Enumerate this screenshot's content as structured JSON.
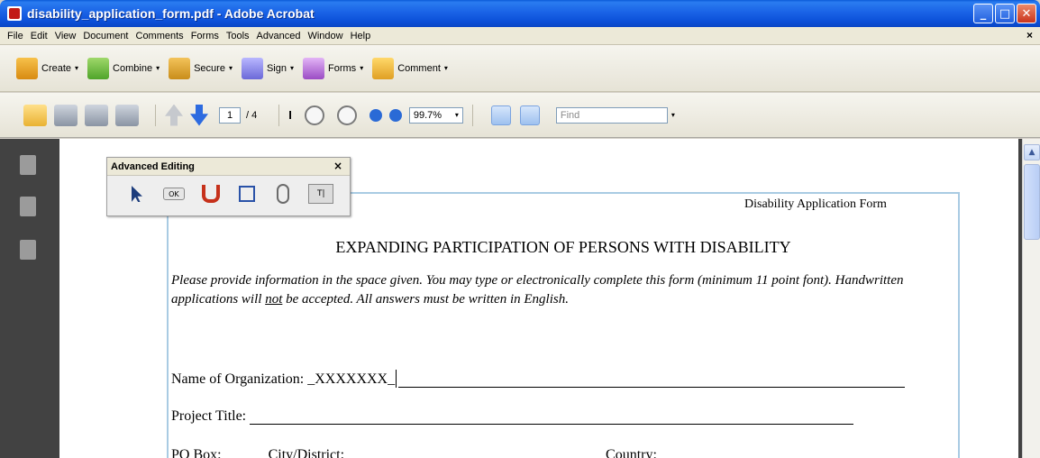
{
  "window": {
    "title": "disability_application_form.pdf - Adobe Acrobat",
    "minimize": "_",
    "maximize": "□",
    "close": "✕"
  },
  "menu": {
    "items": [
      "File",
      "Edit",
      "View",
      "Document",
      "Comments",
      "Forms",
      "Tools",
      "Advanced",
      "Window",
      "Help"
    ],
    "close": "×"
  },
  "toolbar1": {
    "create": "Create",
    "combine": "Combine",
    "secure": "Secure",
    "sign": "Sign",
    "forms": "Forms",
    "comment": "Comment",
    "dropdown_glyph": "▾"
  },
  "toolbar2": {
    "current_page": "1",
    "page_total": "/ 4",
    "select_tool": "I",
    "zoom": "99.7%",
    "dropdown_glyph": "▾",
    "find_placeholder": "Find"
  },
  "palette": {
    "title": "Advanced Editing",
    "close": "×",
    "ok_label": "OK",
    "textfield_label": "T|"
  },
  "document": {
    "header": "Disability Application Form",
    "title": "EXPANDING PARTICIPATION OF PERSONS WITH DISABILITY",
    "instructions_1": "Please provide information in the space given. You may type or electronically complete this form (minimum 11 point font).   Handwritten applications will ",
    "instructions_not": "not",
    "instructions_2": " be accepted.   All answers must be written in English.",
    "org_label": "Name of Organization: ",
    "org_value": "_XXXXXXX_",
    "project_label": "Project Title: ",
    "pobox_label": "PO Box:",
    "city_label": "City/District:",
    "country_label": "Country:"
  },
  "scrollbar": {
    "up_arrow": "▲"
  }
}
